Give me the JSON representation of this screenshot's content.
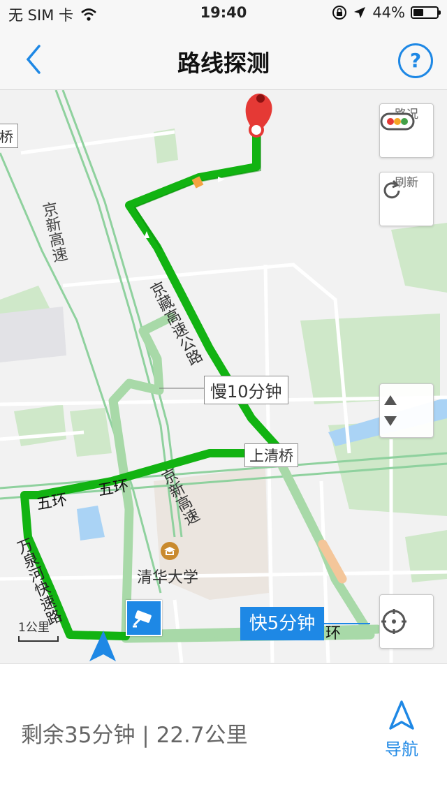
{
  "status_bar": {
    "carrier": "无 SIM 卡",
    "time": "19:40",
    "battery": "44%",
    "battery_level": 0.44
  },
  "header": {
    "title": "路线探测",
    "back_icon": "chevron-left-icon",
    "help_label": "?"
  },
  "map": {
    "road_labels": {
      "bridge_left": "桥",
      "jingxin_upper": "京新高速",
      "jingzang": "京藏高速公路",
      "shangqing": "上清桥",
      "fifth_ring_1": "五环",
      "fifth_ring_2": "五环",
      "jingxin_lower": "京新高速",
      "wanquanhe": "万泉河快速路",
      "tsinghua": "清华大学",
      "ring_right": "环"
    },
    "route_callouts": {
      "slow": "慢10分钟",
      "fast": "快5分钟"
    },
    "controls": {
      "traffic_label": "路况",
      "refresh_label": "刷新"
    },
    "scale_label": "1公里",
    "colors": {
      "route_main": "#12b312",
      "route_alt": "#a8d9a8",
      "congestion": "#f4a442",
      "marker": "#e53935",
      "accent": "#1e88e5"
    }
  },
  "bottom_bar": {
    "remaining": "剩余35分钟 | 22.7公里",
    "nav_label": "导航"
  }
}
